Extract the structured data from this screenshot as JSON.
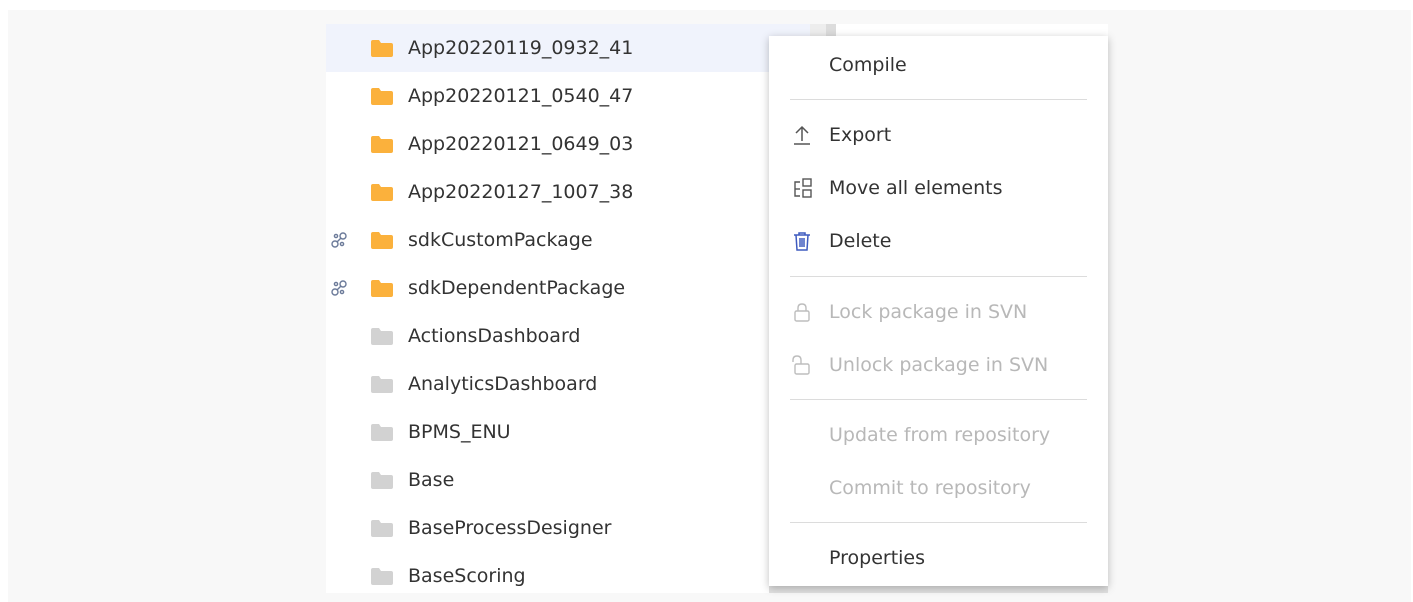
{
  "packages": [
    {
      "name": "App20220119_0932_41",
      "folder_color": "#fbb13c",
      "linked": false,
      "selected": true
    },
    {
      "name": "App20220121_0540_47",
      "folder_color": "#fbb13c",
      "linked": false,
      "selected": false
    },
    {
      "name": "App20220121_0649_03",
      "folder_color": "#fbb13c",
      "linked": false,
      "selected": false
    },
    {
      "name": "App20220127_1007_38",
      "folder_color": "#fbb13c",
      "linked": false,
      "selected": false
    },
    {
      "name": "sdkCustomPackage",
      "folder_color": "#fbb13c",
      "linked": true,
      "selected": false
    },
    {
      "name": "sdkDependentPackage",
      "folder_color": "#fbb13c",
      "linked": true,
      "selected": false
    },
    {
      "name": "ActionsDashboard",
      "folder_color": "#d2d2d2",
      "linked": false,
      "selected": false
    },
    {
      "name": "AnalyticsDashboard",
      "folder_color": "#d2d2d2",
      "linked": false,
      "selected": false
    },
    {
      "name": "BPMS_ENU",
      "folder_color": "#d2d2d2",
      "linked": false,
      "selected": false
    },
    {
      "name": "Base",
      "folder_color": "#d2d2d2",
      "linked": false,
      "selected": false
    },
    {
      "name": "BaseProcessDesigner",
      "folder_color": "#d2d2d2",
      "linked": false,
      "selected": false
    },
    {
      "name": "BaseScoring",
      "folder_color": "#d2d2d2",
      "linked": false,
      "selected": false
    }
  ],
  "context_menu": {
    "items": [
      {
        "label": "Compile",
        "icon": "",
        "enabled": true
      },
      {
        "label": "Export",
        "icon": "export-icon",
        "enabled": true
      },
      {
        "label": "Move all elements",
        "icon": "move-elements-icon",
        "enabled": true
      },
      {
        "label": "Delete",
        "icon": "trash-icon",
        "enabled": true
      },
      {
        "label": "Lock package in SVN",
        "icon": "lock-icon",
        "enabled": false
      },
      {
        "label": "Unlock package in SVN",
        "icon": "unlock-icon",
        "enabled": false
      },
      {
        "label": "Update from repository",
        "icon": "",
        "enabled": false
      },
      {
        "label": "Commit to repository",
        "icon": "",
        "enabled": false
      },
      {
        "label": "Properties",
        "icon": "",
        "enabled": true
      }
    ]
  },
  "colors": {
    "accent_icon": "#3f5bbf",
    "link_icon": "#6b7a99",
    "disabled_text": "#b8b8b8",
    "selected_row": "#f0f3fc"
  }
}
